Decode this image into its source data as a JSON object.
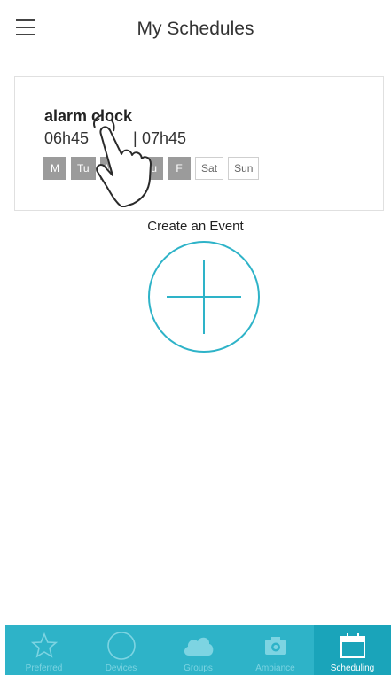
{
  "header": {
    "title": "My Schedules",
    "menu_icon": "hamburger-menu-icon"
  },
  "schedule": {
    "name": "alarm clock",
    "start_time": "06h45",
    "separator": "|",
    "end_time": "07h45",
    "days": [
      {
        "label": "M",
        "active": true
      },
      {
        "label": "Tu",
        "active": true
      },
      {
        "label": "We",
        "active": true
      },
      {
        "label": "Thu",
        "active": true
      },
      {
        "label": "F",
        "active": true
      },
      {
        "label": "Sat",
        "active": false
      },
      {
        "label": "Sun",
        "active": false
      }
    ]
  },
  "create": {
    "label": "Create an Event",
    "icon": "plus-circle-icon"
  },
  "tabs": [
    {
      "label": "Preferred",
      "icon": "star-icon",
      "active": false
    },
    {
      "label": "Devices",
      "icon": "circle-icon",
      "active": false
    },
    {
      "label": "Groups",
      "icon": "cloud-icon",
      "active": false
    },
    {
      "label": "Ambiance",
      "icon": "camera-icon",
      "active": false
    },
    {
      "label": "Scheduling",
      "icon": "calendar-icon",
      "active": true
    }
  ],
  "colors": {
    "accent": "#2eb3c8",
    "active_day": "#9b9b9b"
  }
}
